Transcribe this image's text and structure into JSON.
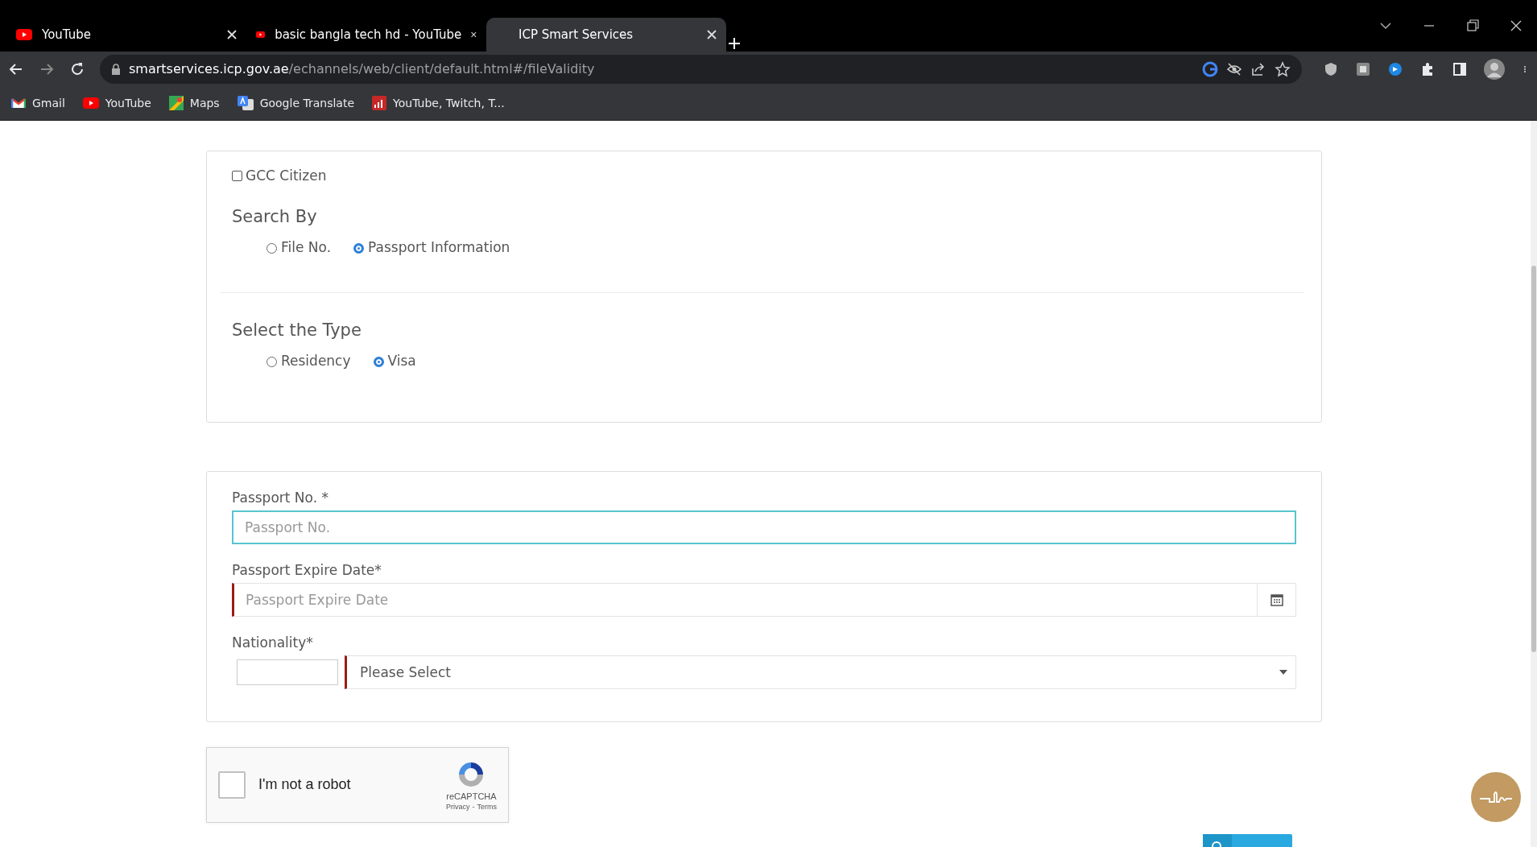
{
  "browser": {
    "tabs": [
      {
        "title": "YouTube",
        "selected": false
      },
      {
        "title": "basic bangla tech hd - YouTube",
        "selected": false
      },
      {
        "title": "ICP Smart Services",
        "selected": true
      }
    ],
    "address": {
      "host": "smartservices.icp.gov.ae",
      "path": "/echannels/web/client/default.html#/fileValidity"
    },
    "bookmarks": [
      "Gmail",
      "YouTube",
      "Maps",
      "Google Translate",
      "YouTube, Twitch, T..."
    ]
  },
  "form": {
    "gcc_citizen": {
      "label": "GCC Citizen",
      "checked": false
    },
    "search_by": {
      "title": "Search By",
      "options": [
        {
          "label": "File No.",
          "selected": false
        },
        {
          "label": "Passport Information",
          "selected": true
        }
      ]
    },
    "select_type": {
      "title": "Select the Type",
      "options": [
        {
          "label": "Residency",
          "selected": false
        },
        {
          "label": "Visa",
          "selected": true
        }
      ]
    },
    "fields": [
      {
        "kind": "text",
        "label": "Passport No. *",
        "placeholder": "Passport No.",
        "focused": true,
        "invalid": false
      },
      {
        "kind": "date",
        "label": "Passport Expire Date*",
        "placeholder": "Passport Expire Date",
        "focused": false,
        "invalid": true
      },
      {
        "kind": "select",
        "label": "Nationality*",
        "placeholder": "Please Select",
        "focused": false,
        "invalid": true
      }
    ]
  },
  "captcha": {
    "label": "I'm not a robot",
    "checked": false,
    "brand": "reCAPTCHA",
    "links": [
      "Privacy",
      "Terms"
    ],
    "separator": "-"
  }
}
